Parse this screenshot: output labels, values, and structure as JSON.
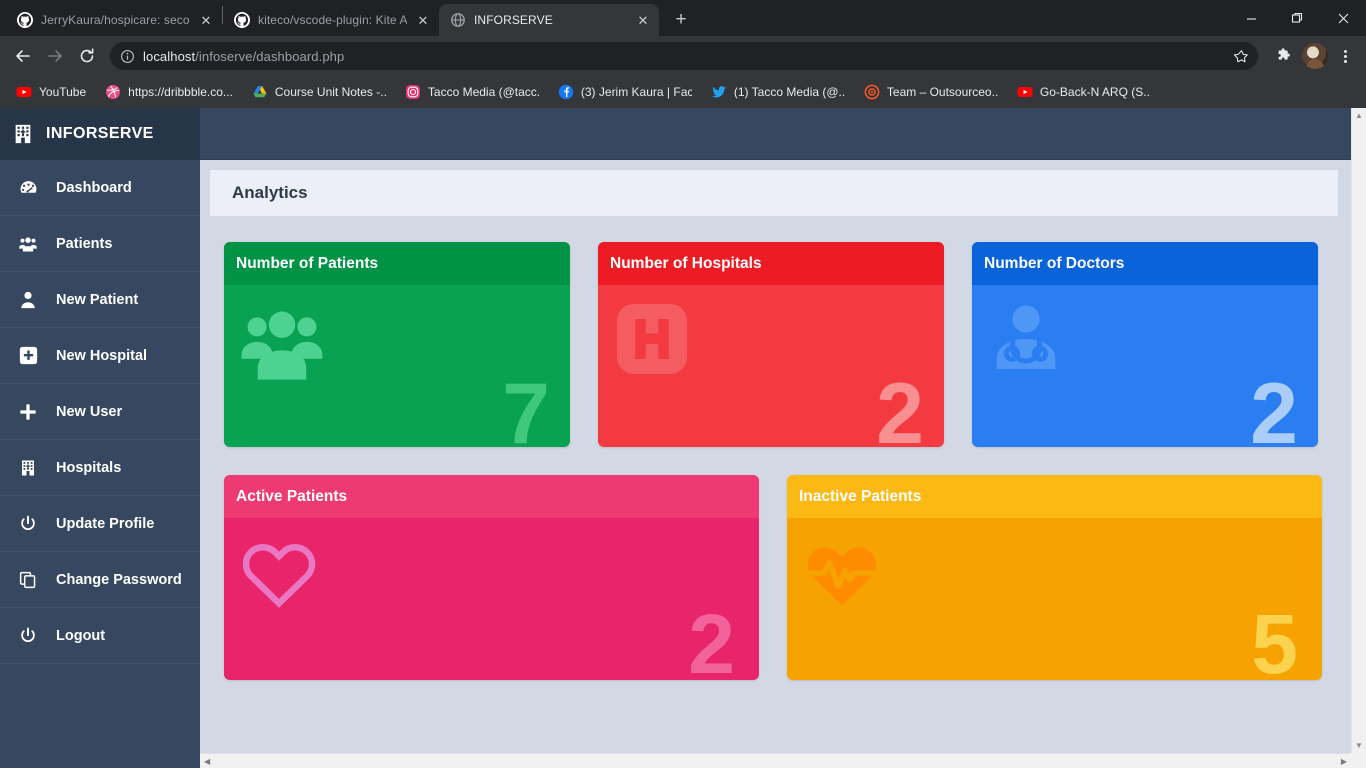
{
  "browser": {
    "tabs": [
      {
        "title": "JerryKaura/hospicare: second yea",
        "icon": "github-icon",
        "active": false
      },
      {
        "title": "kiteco/vscode-plugin: Kite Autoc",
        "icon": "github-icon",
        "active": false
      },
      {
        "title": "INFORSERVE",
        "icon": "globe-icon",
        "active": true
      }
    ],
    "new_tab_label": "+",
    "window_controls": {
      "minimize": "—",
      "maximize": "❐",
      "close": "✕"
    },
    "nav": {
      "back": "←",
      "forward": "→",
      "reload": "⟳"
    },
    "address": {
      "security_icon": "info-circle-icon",
      "host": "localhost",
      "path": "/infoserve/dashboard.php",
      "star_icon": "star-icon"
    },
    "toolbar_right": {
      "extensions_icon": "puzzle-icon",
      "profile_icon": "avatar-icon",
      "menu_icon": "kebab-menu-icon"
    },
    "bookmarks": [
      {
        "label": "YouTube",
        "icon": "youtube-icon"
      },
      {
        "label": "https://dribbble.co...",
        "icon": "dribbble-icon"
      },
      {
        "label": "Course Unit Notes -...",
        "icon": "google-drive-icon"
      },
      {
        "label": "Tacco Media (@tacc...",
        "icon": "instagram-icon"
      },
      {
        "label": "(3) Jerim Kaura | Fac...",
        "icon": "facebook-icon"
      },
      {
        "label": "(1) Tacco Media (@...",
        "icon": "twitter-icon"
      },
      {
        "label": "Team – Outsourceo...",
        "icon": "target-icon"
      },
      {
        "label": "Go-Back-N ARQ (S...",
        "icon": "youtube-icon"
      }
    ]
  },
  "app": {
    "brand": {
      "label": "INFORSERVE",
      "icon": "hospital-building-icon"
    },
    "sidebar": {
      "items": [
        {
          "label": "Dashboard",
          "icon": "dashboard-gauge-icon"
        },
        {
          "label": "Patients",
          "icon": "users-group-icon"
        },
        {
          "label": "New Patient",
          "icon": "user-icon"
        },
        {
          "label": "New Hospital",
          "icon": "plus-square-icon"
        },
        {
          "label": "New User",
          "icon": "plus-icon"
        },
        {
          "label": "Hospitals",
          "icon": "hospital-building-icon"
        },
        {
          "label": "Update Profile",
          "icon": "power-icon"
        },
        {
          "label": "Change Password",
          "icon": "copy-icon"
        },
        {
          "label": "Logout",
          "icon": "power-icon"
        }
      ]
    },
    "panel": {
      "title": "Analytics"
    },
    "cards": [
      {
        "title": "Number of Patients",
        "value": "7",
        "icon": "users-group-icon",
        "size": "third",
        "colors": {
          "head": "#009245",
          "body": "#09a253",
          "value": "#3ec77d",
          "icon": "#4ed291"
        }
      },
      {
        "title": "Number of Hospitals",
        "value": "2",
        "icon": "hospital-h-icon",
        "size": "third",
        "colors": {
          "head": "#ed1c24",
          "body": "#f33a41",
          "value": "#fa8f92",
          "icon": "#f55c62"
        }
      },
      {
        "title": "Number of Doctors",
        "value": "2",
        "icon": "doctor-icon",
        "size": "third",
        "colors": {
          "head": "#0b63da",
          "body": "#2a7ef1",
          "value": "#aacdf9",
          "icon": "#4e97f5"
        }
      },
      {
        "title": "Active Patients",
        "value": "2",
        "icon": "heart-outline-icon",
        "size": "half",
        "colors": {
          "head": "#ed3a73",
          "body": "#e8246b",
          "value": "#f3639b",
          "icon": "#e977c3"
        }
      },
      {
        "title": "Inactive Patients",
        "value": "5",
        "icon": "heartbeat-icon",
        "size": "half",
        "colors": {
          "head": "#fdb913",
          "body": "#f6a200",
          "value": "#fbd34e",
          "icon": "#ff8c00"
        }
      }
    ],
    "scrollbars": {
      "h_left_arrow": "◀",
      "h_right_arrow": "▶",
      "v_up_arrow": "▲",
      "v_down_arrow": "▼"
    }
  }
}
